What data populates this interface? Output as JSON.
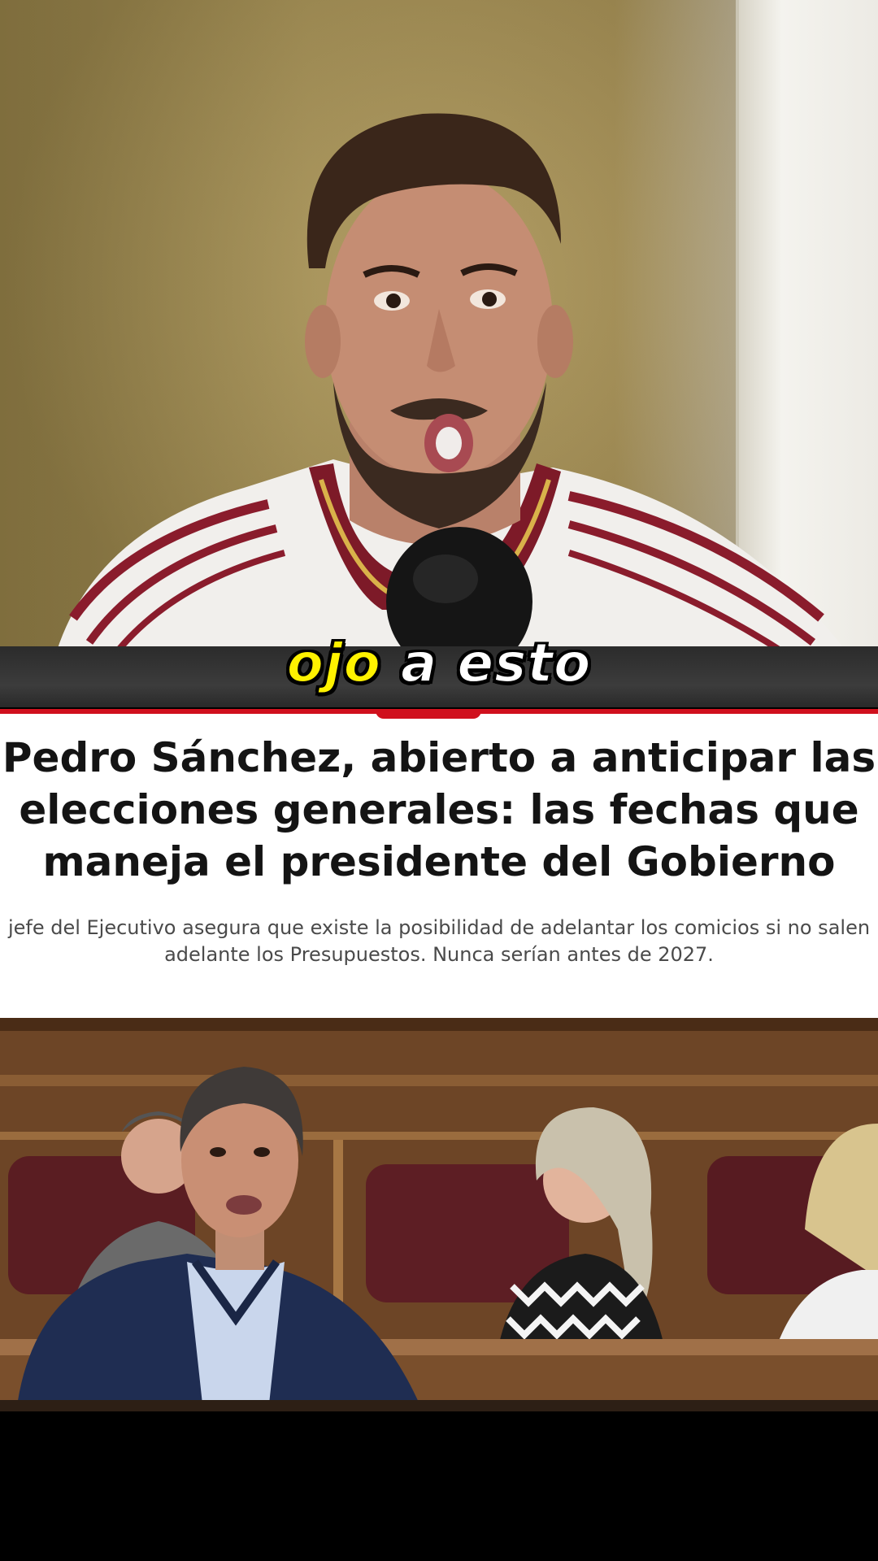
{
  "video": {
    "caption_highlight": "ojo",
    "caption_rest": "a esto"
  },
  "article": {
    "headline_lines": [
      "Pedro Sánchez, abierto a anticipar las",
      "elecciones generales: las fechas que",
      "maneja el presidente del Gobierno"
    ],
    "subhead_lines": [
      "jefe del Ejecutivo asegura que existe la posibilidad de adelantar los comicios si no salen",
      "adelante los Presupuestos. Nunca serían antes de 2027."
    ]
  },
  "colors": {
    "accent_red": "#d0101d",
    "caption_yellow": "#fff200"
  }
}
